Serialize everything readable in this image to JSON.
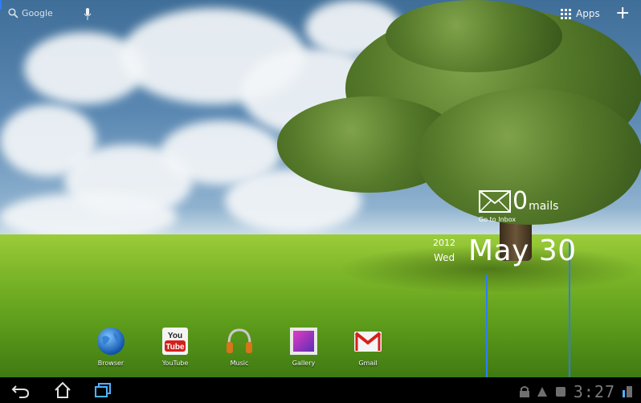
{
  "top_bar": {
    "search_label": "Google",
    "apps_label": "Apps",
    "add_label": "+"
  },
  "mail_widget": {
    "count": "0",
    "unit_label": "mails",
    "inbox_label": "Go to Inbox"
  },
  "date_widget": {
    "year": "2012",
    "weekday": "Wed",
    "date": "May 30"
  },
  "apps": [
    {
      "label": "Browser",
      "icon": "globe-icon"
    },
    {
      "label": "YouTube",
      "icon": "youtube-icon",
      "icon_text": "You\nTube"
    },
    {
      "label": "Music",
      "icon": "headphones-icon"
    },
    {
      "label": "Gallery",
      "icon": "gallery-icon"
    },
    {
      "label": "Gmail",
      "icon": "gmail-icon"
    }
  ],
  "nav_bar": {
    "clock": "3:27"
  },
  "colors": {
    "accent_blue": "#2d7dff",
    "nav_bar_bg": "#000000"
  }
}
